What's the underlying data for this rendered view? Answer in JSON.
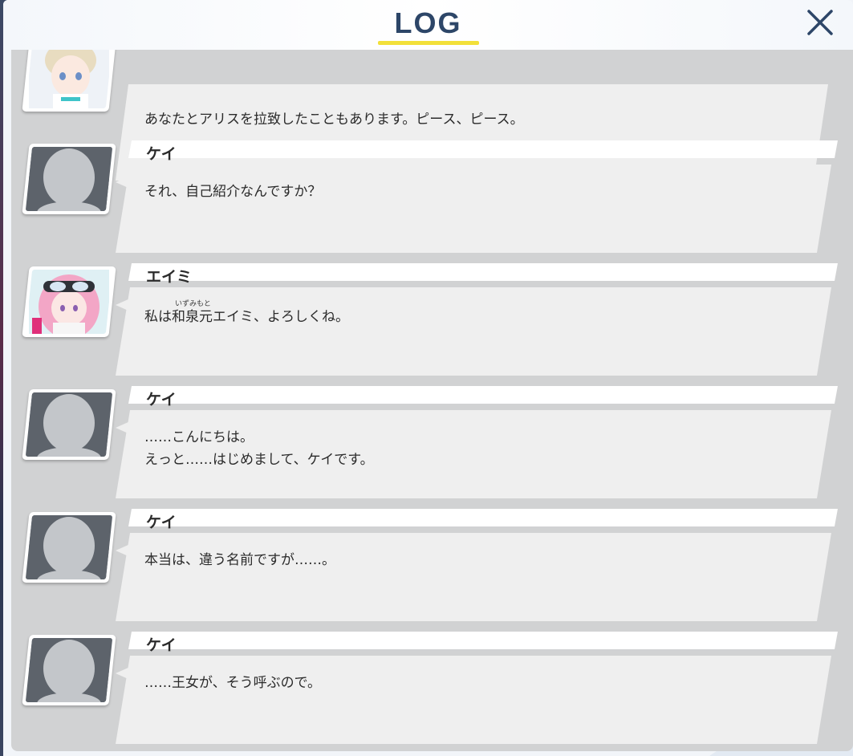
{
  "header": {
    "title": "LOG",
    "close_icon": "close-icon"
  },
  "colors": {
    "title": "#2d4668",
    "accent": "#f2e03a",
    "panel": "#d1d2d3",
    "bubble": "#efefef"
  },
  "entries": [
    {
      "speaker": "",
      "avatar": "arisu-portrait",
      "lines": [
        "あなたとアリスを拉致したこともあります。ピース、ピース。"
      ]
    },
    {
      "speaker": "ケイ",
      "avatar": "silhouette",
      "lines": [
        "それ、自己紹介なんですか？"
      ]
    },
    {
      "speaker": "エイミ",
      "avatar": "eimi-portrait",
      "lines": [
        "私は和泉元エイミ、よろしくね。"
      ],
      "furigana": "いずみもと"
    },
    {
      "speaker": "ケイ",
      "avatar": "silhouette",
      "lines": [
        "……こんにちは。",
        "えっと……はじめまして、ケイです。"
      ]
    },
    {
      "speaker": "ケイ",
      "avatar": "silhouette",
      "lines": [
        "本当は、違う名前ですが……。"
      ]
    },
    {
      "speaker": "ケイ",
      "avatar": "silhouette",
      "lines": [
        "……王女が、そう呼ぶので。"
      ]
    }
  ]
}
